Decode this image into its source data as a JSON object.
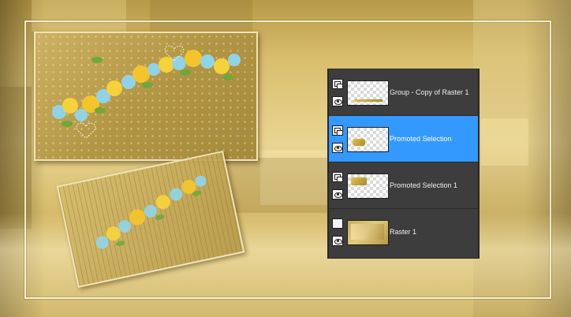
{
  "layers_panel": {
    "layers": [
      {
        "name": "Group - Copy of Raster 1",
        "type_icon": "group-layer-icon",
        "visible_icon": "eye-icon",
        "selected": false,
        "thumbnail": "transparent-strip"
      },
      {
        "name": "Promoted Selection",
        "type_icon": "group-layer-icon",
        "visible_icon": "eye-icon",
        "selected": true,
        "thumbnail": "transparent-with-flowers"
      },
      {
        "name": "Promoted Selection 1",
        "type_icon": "group-layer-icon",
        "visible_icon": "eye-icon",
        "selected": false,
        "thumbnail": "transparent-with-flowers"
      },
      {
        "name": "Raster 1",
        "type_icon": "raster-layer-icon",
        "visible_icon": "eye-icon",
        "selected": false,
        "thumbnail": "gold-background"
      }
    ],
    "colors": {
      "panel_bg": "#3c3c3c",
      "selected_bg": "#3399ff",
      "text": "#f0f0f0"
    }
  },
  "artwork": {
    "palette": [
      "#e9d591",
      "#c3a552",
      "#b39644",
      "#f6d23a",
      "#8fd3e8",
      "#6fa83a"
    ]
  }
}
